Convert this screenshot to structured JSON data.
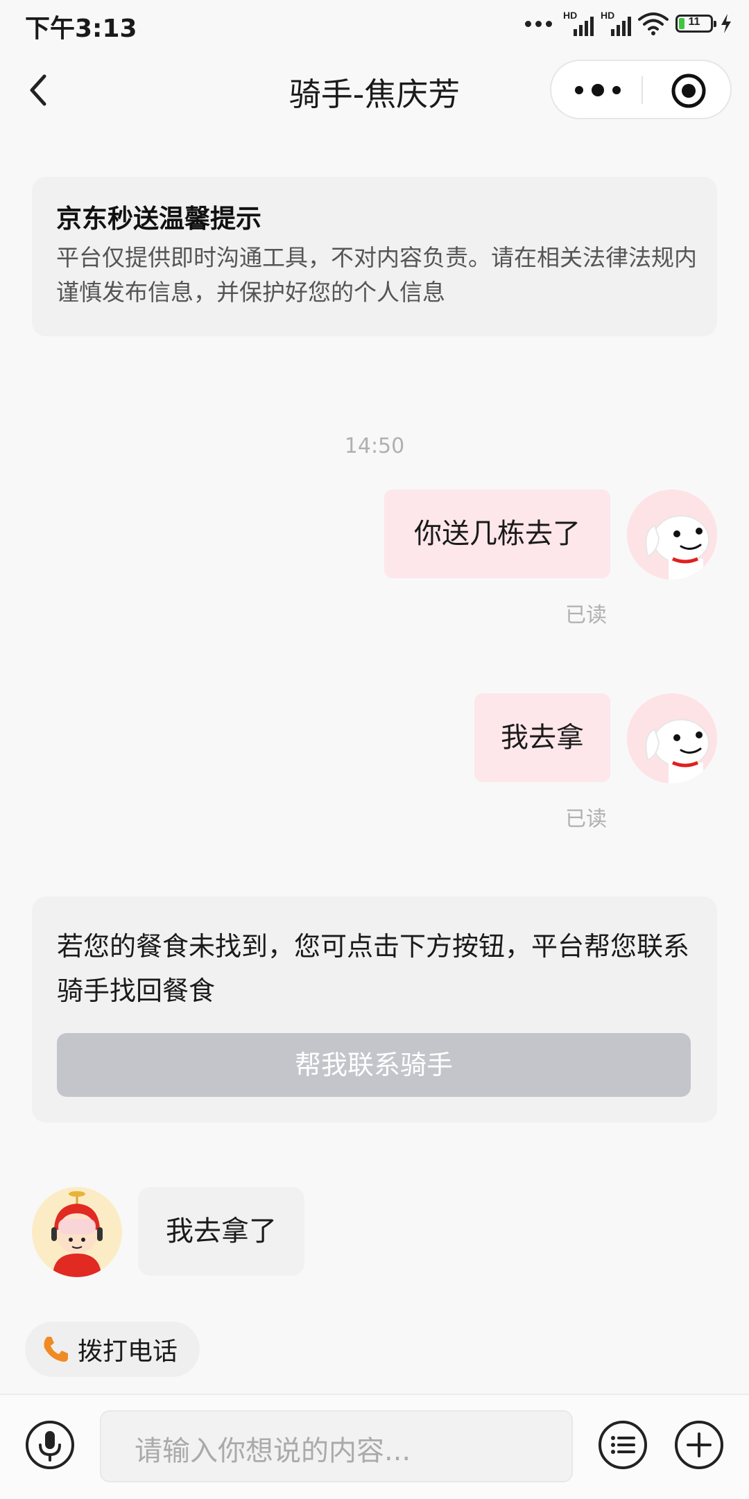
{
  "status_bar": {
    "time": "下午3:13",
    "network1": "HD",
    "network2": "HD",
    "battery": "11"
  },
  "nav": {
    "title": "骑手-焦庆芳"
  },
  "notice": {
    "title": "京东秒送温馨提示",
    "body": "平台仅提供即时沟通工具，不对内容负责。请在相关法律法规内谨慎发布信息，并保护好您的个人信息"
  },
  "chat": {
    "timestamp": "14:50",
    "messages": [
      {
        "side": "right",
        "text": "你送几栋去了",
        "status": "已读"
      },
      {
        "side": "right",
        "text": "我去拿",
        "status": "已读"
      },
      {
        "side": "left",
        "text": "我去拿了"
      }
    ]
  },
  "prompt_card": {
    "text": "若您的餐食未找到，您可点击下方按钮，平台帮您联系骑手找回餐食",
    "button_label": "帮我联系骑手"
  },
  "quick_action": {
    "call_label": "拨打电话"
  },
  "composer": {
    "placeholder": "请输入你想说的内容..."
  },
  "colors": {
    "my_bubble": "#fde7ea",
    "their_bubble": "#f1f1f1",
    "disabled_button": "#c3c5cb",
    "phone_icon": "#f08a24"
  },
  "icons": [
    "back-arrow-icon",
    "more-dots-icon",
    "target-icon",
    "phone-icon",
    "microphone-icon",
    "list-icon",
    "plus-icon"
  ]
}
